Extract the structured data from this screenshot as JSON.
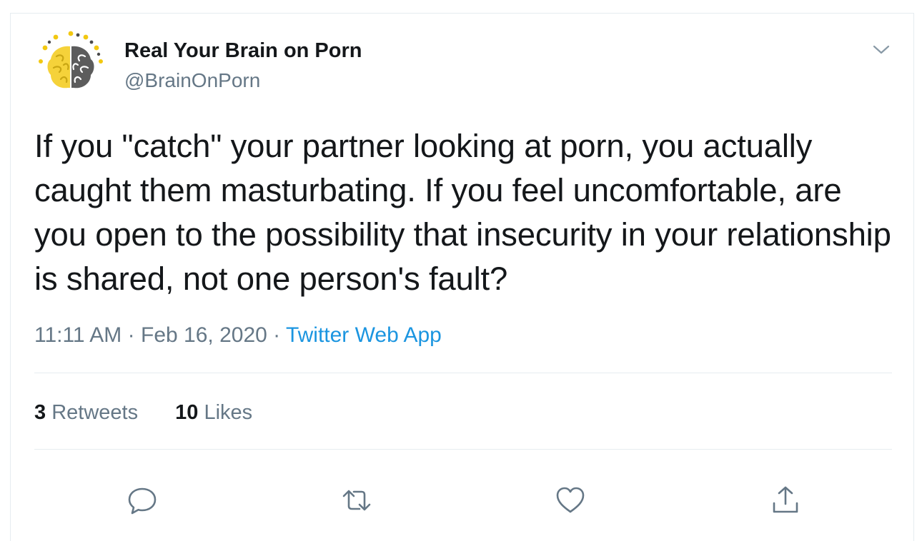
{
  "tweet": {
    "author_name": "Real Your Brain on Porn",
    "author_handle": "@BrainOnPorn",
    "text": "If you \"catch\" your partner looking at porn, you actually caught them masturbating. If you feel uncomfortable, are you open to the possibility that insecurity in your relationship is shared, not one person's fault?",
    "time": "11:11 AM",
    "date": "Feb 16, 2020",
    "separator": "·",
    "source": "Twitter Web App",
    "retweets_count": "3",
    "retweets_label": "Retweets",
    "likes_count": "10",
    "likes_label": "Likes"
  },
  "icons": {
    "avatar": "brain-logo",
    "menu": "chevron-down-icon",
    "reply": "reply-icon",
    "retweet": "retweet-icon",
    "like": "heart-icon",
    "share": "share-icon"
  },
  "colors": {
    "text": "#14171a",
    "secondary": "#657786",
    "link": "#1b95e0",
    "border": "#e6ecf0",
    "logo_yellow": "#f5d23a",
    "logo_gray": "#5c5c5c"
  }
}
